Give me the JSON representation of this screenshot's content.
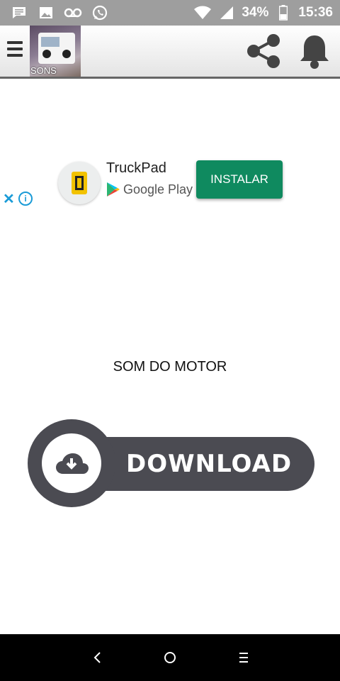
{
  "status_bar": {
    "battery": "34%",
    "time": "15:36",
    "left_icons": [
      "message-icon",
      "image-icon",
      "voicemail-icon",
      "whatsapp-icon"
    ],
    "right_icons": [
      "wifi-icon",
      "signal-icon",
      "battery-icon"
    ]
  },
  "app_bar": {
    "logo_label": "SONS",
    "icons": [
      "menu-icon",
      "share-icon",
      "bell-icon"
    ]
  },
  "ad": {
    "app_name": "TruckPad",
    "store": "Google Play",
    "install_label": "INSTALAR",
    "close_glyph": "✕",
    "info_glyph": "i",
    "accent_color": "#0f8a5f"
  },
  "main": {
    "title": "SOM DO MOTOR",
    "download_label": "DOWNLOAD"
  },
  "nav_bar": {
    "buttons": [
      "back-icon",
      "home-icon",
      "recents-icon"
    ]
  }
}
